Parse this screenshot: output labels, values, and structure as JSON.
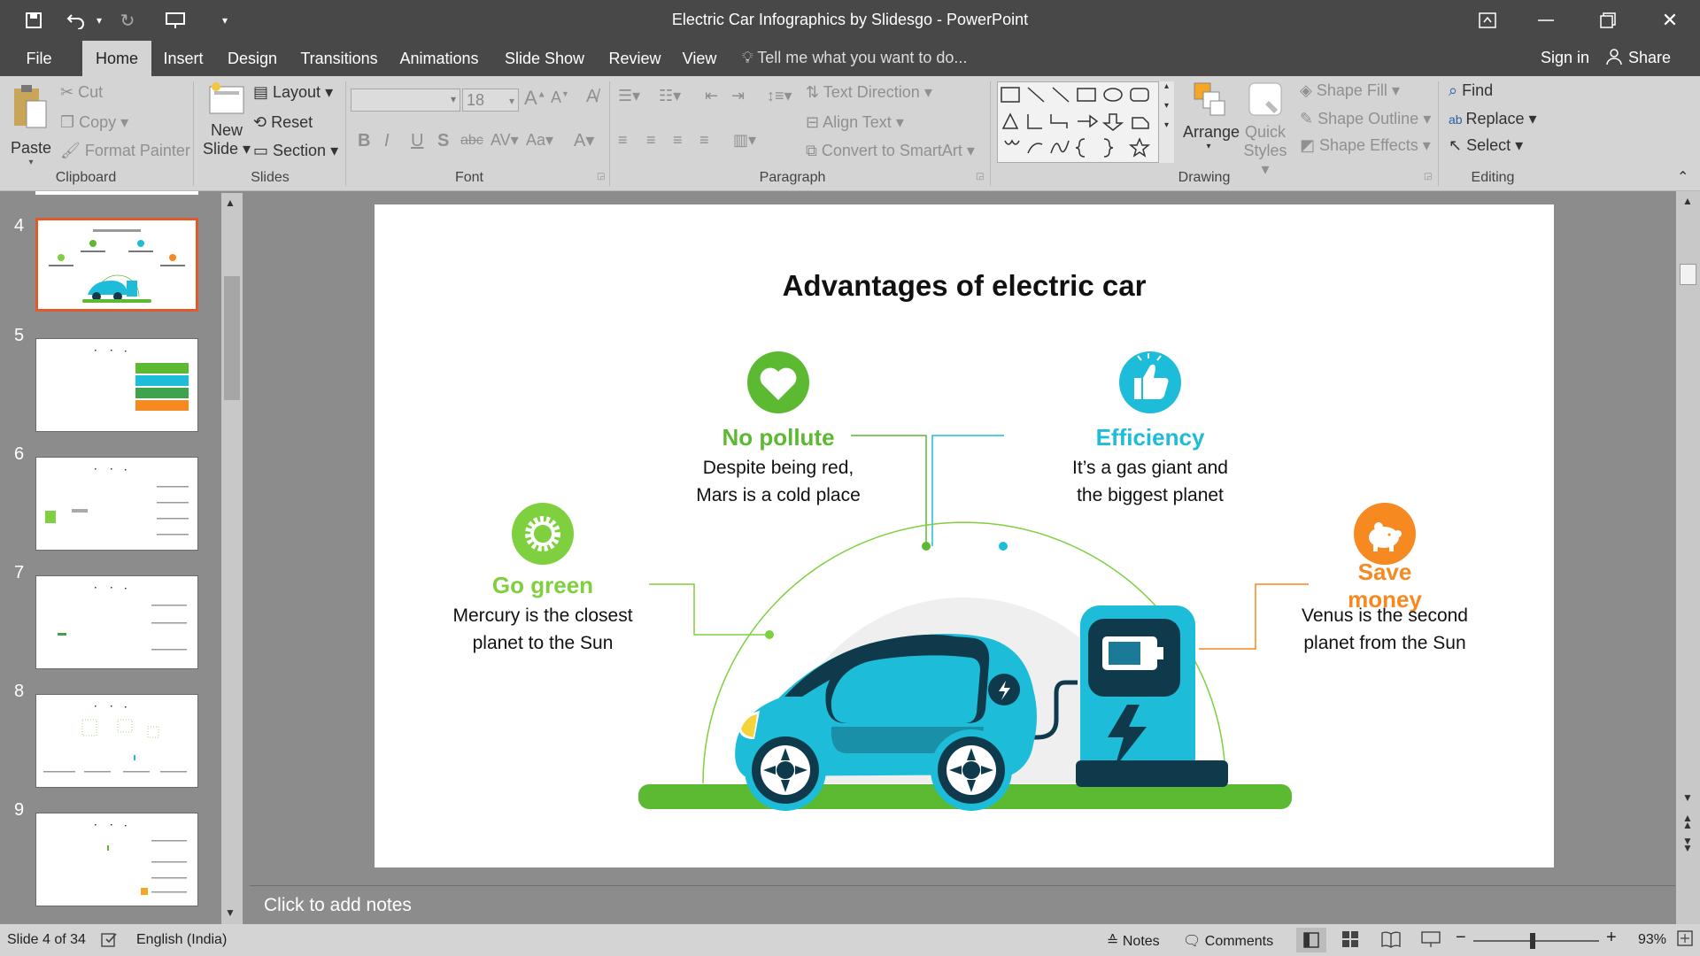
{
  "window": {
    "title": "Electric Car Infographics by Slidesgo - PowerPoint"
  },
  "tabs": [
    "File",
    "Home",
    "Insert",
    "Design",
    "Transitions",
    "Animations",
    "Slide Show",
    "Review",
    "View"
  ],
  "tell_me": "Tell me what you want to do...",
  "account": {
    "sign_in": "Sign in",
    "share": "Share"
  },
  "ribbon": {
    "clipboard": {
      "paste": "Paste",
      "cut": "Cut",
      "copy": "Copy",
      "format_painter": "Format Painter",
      "group": "Clipboard"
    },
    "slides": {
      "new_slide_1": "New",
      "new_slide_2": "Slide",
      "layout": "Layout",
      "reset": "Reset",
      "section": "Section",
      "group": "Slides"
    },
    "font": {
      "size": "18",
      "group": "Font"
    },
    "paragraph": {
      "text_direction": "Text Direction",
      "align_text": "Align Text",
      "convert_smartart": "Convert to SmartArt",
      "group": "Paragraph"
    },
    "drawing": {
      "arrange": "Arrange",
      "quick_styles_1": "Quick",
      "quick_styles_2": "Styles",
      "shape_fill": "Shape Fill",
      "shape_outline": "Shape Outline",
      "shape_effects": "Shape Effects",
      "group": "Drawing"
    },
    "editing": {
      "find": "Find",
      "replace": "Replace",
      "select": "Select",
      "group": "Editing"
    }
  },
  "thumbnails": [
    "4",
    "5",
    "6",
    "7",
    "8",
    "9"
  ],
  "slide": {
    "title": "Advantages of electric car",
    "items": [
      {
        "heading": "No pollute",
        "line1": "Despite being red,",
        "line2": "Mars is a cold place",
        "color": "#5cb932"
      },
      {
        "heading": "Efficiency",
        "line1": "It’s a gas giant and",
        "line2": "the biggest planet",
        "color": "#1dbdd9"
      },
      {
        "heading": "Go green",
        "line1": "Mercury is the closest",
        "line2": "planet to the Sun",
        "color": "#7ed03f"
      },
      {
        "heading_1": "Save",
        "heading_2": "money",
        "line1": "Venus is the second",
        "line2": "planet from the Sun",
        "color": "#f6891f"
      }
    ]
  },
  "notes_placeholder": "Click to add notes",
  "status": {
    "slide_info": "Slide 4 of 34",
    "language": "English (India)",
    "notes": "Notes",
    "comments": "Comments",
    "zoom": "93%"
  }
}
